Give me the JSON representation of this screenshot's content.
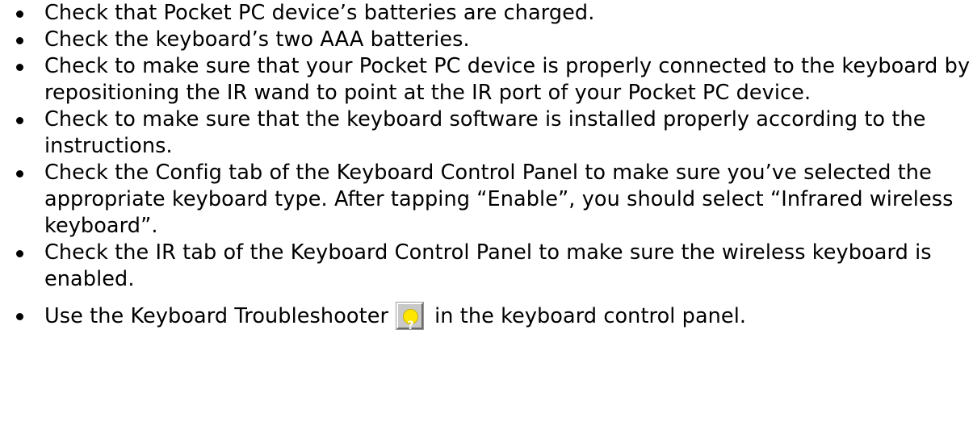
{
  "items": [
    {
      "text": "Check that Pocket PC device’s batteries are charged."
    },
    {
      "text": "Check the keyboard’s two AAA batteries."
    },
    {
      "text": "Check to make sure that your Pocket PC device is properly connected to the keyboard by repositioning the IR wand to point at the IR port of your Pocket PC device."
    },
    {
      "text": "Check to make sure that the keyboard software is installed properly according to the instructions."
    },
    {
      "text": "Check the Config tab of the Keyboard Control Panel to make sure you’ve selected the appropriate keyboard type.  After tapping “Enable”, you should select “Infrared wireless keyboard”."
    },
    {
      "text": "Check the IR tab of the Keyboard Control Panel to make sure the wireless keyboard is enabled."
    },
    {
      "text_before": "Use the Keyboard Troubleshooter",
      "text_after": "in the keyboard control panel."
    }
  ],
  "troubleshooter_button": {
    "icon": "help-question-icon",
    "glyph": "?",
    "accent_color": "#ffe600"
  }
}
